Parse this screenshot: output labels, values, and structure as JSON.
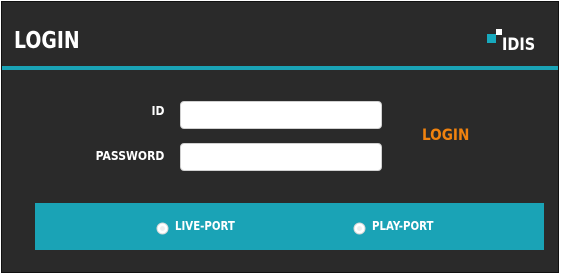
{
  "window": {
    "title": "LOGIN"
  },
  "logo": {
    "text": "IDIS",
    "icon": "idis-logo-mark"
  },
  "form": {
    "id_label": "ID",
    "id_value": "",
    "password_label": "PASSWORD",
    "password_value": "",
    "login_label": "LOGIN"
  },
  "ports": {
    "options": [
      {
        "label": "LIVE-PORT",
        "icon": "radio-icon"
      },
      {
        "label": "PLAY-PORT",
        "icon": "radio-icon"
      }
    ]
  },
  "colors": {
    "background": "#2a2a2a",
    "accent": "#1aa3b6",
    "login_text": "#f0820f",
    "text": "#ffffff"
  }
}
